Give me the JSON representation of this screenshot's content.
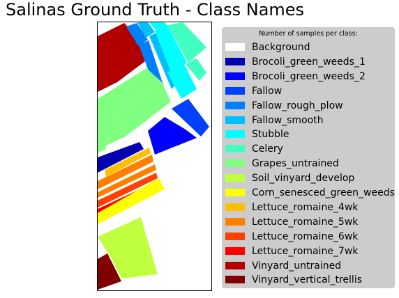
{
  "figure": {
    "title": "Salinas Ground Truth - Class Names"
  },
  "chart_data": {
    "type": "heatmap",
    "title": "Salinas Ground Truth - Class Names",
    "xlabel": "",
    "ylabel": "",
    "grid": false,
    "legend": {
      "title": "Number of samples per class:",
      "placement": "right"
    },
    "classes": [
      {
        "name": "Background",
        "color": "#ffffff"
      },
      {
        "name": "Brocoli_green_weeds_1",
        "color": "#0000b2"
      },
      {
        "name": "Brocoli_green_weeds_2",
        "color": "#0000ff"
      },
      {
        "name": "Fallow",
        "color": "#0040ff"
      },
      {
        "name": "Fallow_rough_plow",
        "color": "#0080ff"
      },
      {
        "name": "Fallow_smooth",
        "color": "#00bfff"
      },
      {
        "name": "Stubble",
        "color": "#00ffff"
      },
      {
        "name": "Celery",
        "color": "#40ffc0"
      },
      {
        "name": "Grapes_untrained",
        "color": "#80ff80"
      },
      {
        "name": "Soil_vinyard_develop",
        "color": "#c0ff40"
      },
      {
        "name": "Corn_senesced_green_weeds",
        "color": "#ffff00"
      },
      {
        "name": "Lettuce_romaine_4wk",
        "color": "#ffbf00"
      },
      {
        "name": "Lettuce_romaine_5wk",
        "color": "#ff8000"
      },
      {
        "name": "Lettuce_romaine_6wk",
        "color": "#ff4000"
      },
      {
        "name": "Lettuce_romaine_7wk",
        "color": "#ff0000"
      },
      {
        "name": "Vinyard_untrained",
        "color": "#b20000"
      },
      {
        "name": "Vinyard_vertical_trellis",
        "color": "#800000"
      }
    ]
  }
}
